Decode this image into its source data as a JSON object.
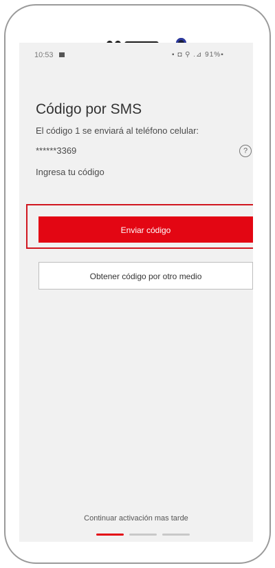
{
  "status_bar": {
    "time": "10:53",
    "right_icons": "▪ ◘ ⚲ .⊿ 91%▪"
  },
  "screen": {
    "title": "Código por SMS",
    "description": "El código 1 se enviará al teléfono celular:",
    "masked_phone": "******3369",
    "prompt": "Ingresa tu código",
    "help_icon": "?"
  },
  "buttons": {
    "send_code": "Enviar código",
    "other_method": "Obtener código por otro medio"
  },
  "footer": {
    "later_link": "Continuar activación mas tarde",
    "progress_steps": 3,
    "active_step": 1
  },
  "colors": {
    "primary": "#e30613",
    "highlight_border": "#d0161f",
    "inactive_step": "#c8c8c8"
  }
}
